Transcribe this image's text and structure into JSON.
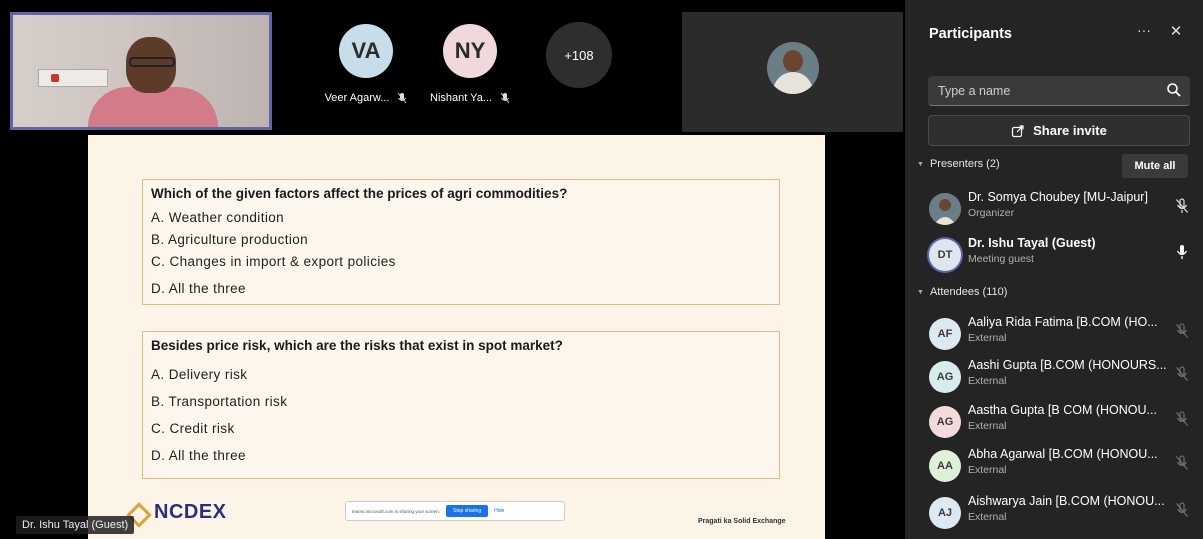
{
  "stage": {
    "tiles": [
      {
        "initials": "VA",
        "name": "Veer Agarw...",
        "color": "#c7dde9"
      },
      {
        "initials": "NY",
        "name": "Nishant Ya...",
        "color": "#f0d8dd"
      }
    ],
    "more_count": "+108",
    "speaker_label": "Dr. Ishu Tayal (Guest)"
  },
  "slide": {
    "q1": {
      "title": "Which of the given factors affect the prices of agri commodities?",
      "options": [
        "A.  Weather condition",
        "B.  Agriculture production",
        "C.  Changes in import & export policies",
        "D.  All the three"
      ]
    },
    "q2": {
      "title": "Besides price risk, which are the risks that exist in spot market?",
      "options": [
        "A. Delivery risk",
        "B. Transportation risk",
        "C. Credit risk",
        "D. All the three"
      ]
    },
    "logo_text": "NCDEX",
    "tagline": "Pragati ka Solid Exchange",
    "share_banner": {
      "message": "teams.microsoft.com is sharing your screen.",
      "stop_label": "Stop sharing",
      "hide_label": "Hide"
    }
  },
  "panel": {
    "title": "Participants",
    "search_placeholder": "Type a name",
    "share_invite_label": "Share invite",
    "presenters_label": "Presenters (2)",
    "mute_all_label": "Mute all",
    "attendees_label": "Attendees (110)",
    "presenters": [
      {
        "name": "Dr. Somya Choubey [MU-Jaipur]",
        "role": "Organizer",
        "initials": "",
        "color": "#6b7d86",
        "mic": "muted"
      },
      {
        "name": "Dr. Ishu Tayal (Guest)",
        "role": "Meeting guest",
        "initials": "DT",
        "color": "#dde7ef",
        "mic": "on"
      }
    ],
    "attendees": [
      {
        "initials": "AF",
        "name": "Aaliya Rida Fatima [B.COM (HO...",
        "role": "External",
        "color": "#dce8f2"
      },
      {
        "initials": "AG",
        "name": "Aashi Gupta [B.COM (HONOURS...",
        "role": "External",
        "color": "#d8ecee"
      },
      {
        "initials": "AG",
        "name": "Aastha Gupta [B COM (HONOU...",
        "role": "External",
        "color": "#f3dadd"
      },
      {
        "initials": "AA",
        "name": "Abha Agarwal [B.COM (HONOU...",
        "role": "External",
        "color": "#dff0d9"
      },
      {
        "initials": "AJ",
        "name": "Aishwarya Jain [B.COM (HONOU...",
        "role": "External",
        "color": "#dce8f2"
      }
    ]
  }
}
